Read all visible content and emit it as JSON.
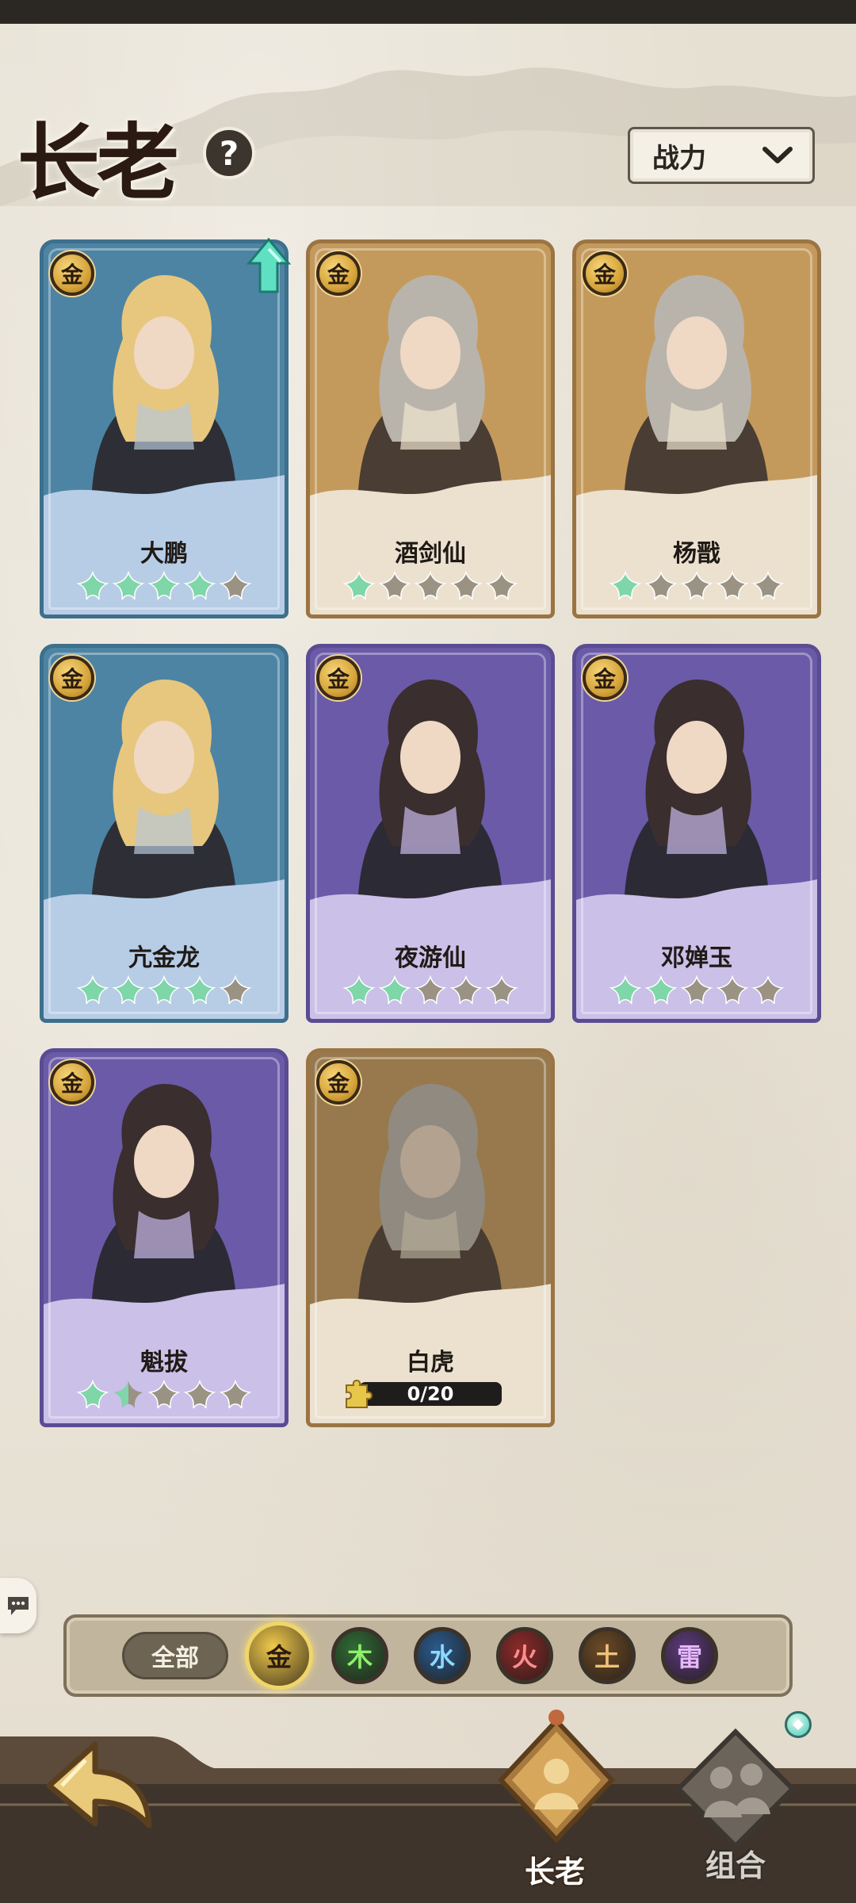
{
  "header": {
    "title": "长老",
    "help_symbol": "?",
    "sort": {
      "label": "战力",
      "icon": "chevron-down-icon"
    }
  },
  "heroes": [
    {
      "name": "大鹏",
      "tier": "金",
      "frame": "blue",
      "stars_filled": 4,
      "stars_total": 5,
      "upgrade_available": true
    },
    {
      "name": "酒剑仙",
      "tier": "金",
      "frame": "gold",
      "stars_filled": 1,
      "stars_total": 5
    },
    {
      "name": "杨戬",
      "tier": "金",
      "frame": "gold",
      "stars_filled": 1,
      "stars_total": 5
    },
    {
      "name": "亢金龙",
      "tier": "金",
      "frame": "blue",
      "stars_filled": 4,
      "stars_total": 5
    },
    {
      "name": "夜游仙",
      "tier": "金",
      "frame": "purple",
      "stars_filled": 2,
      "stars_total": 5
    },
    {
      "name": "邓婵玉",
      "tier": "金",
      "frame": "purple",
      "stars_filled": 2,
      "stars_total": 5
    },
    {
      "name": "魁拔",
      "tier": "金",
      "frame": "purple",
      "stars_filled": 1.5,
      "stars_total": 5
    },
    {
      "name": "白虎",
      "tier": "金",
      "frame": "gold",
      "locked": true,
      "shards": "0/20"
    }
  ],
  "filters": {
    "all_label": "全部",
    "elements": [
      {
        "label": "金",
        "color": "#f1c94a",
        "text_color": "#2a1b0c",
        "selected": true
      },
      {
        "label": "木",
        "color": "#2f6b36",
        "text_color": "#8ef06a"
      },
      {
        "label": "水",
        "color": "#2a5a8c",
        "text_color": "#8fd8ff"
      },
      {
        "label": "火",
        "color": "#8c2a2a",
        "text_color": "#ff8e8e"
      },
      {
        "label": "土",
        "color": "#6b4a26",
        "text_color": "#f0c27a"
      },
      {
        "label": "雷",
        "color": "#5a3a7a",
        "text_color": "#e7b8ff"
      }
    ]
  },
  "bottom_nav": {
    "elder_label": "长老",
    "combo_label": "组合"
  },
  "colors": {
    "star_filled": "#7fd6a8",
    "star_empty": "#9a9384",
    "tier_badge": "#e3b44c"
  }
}
